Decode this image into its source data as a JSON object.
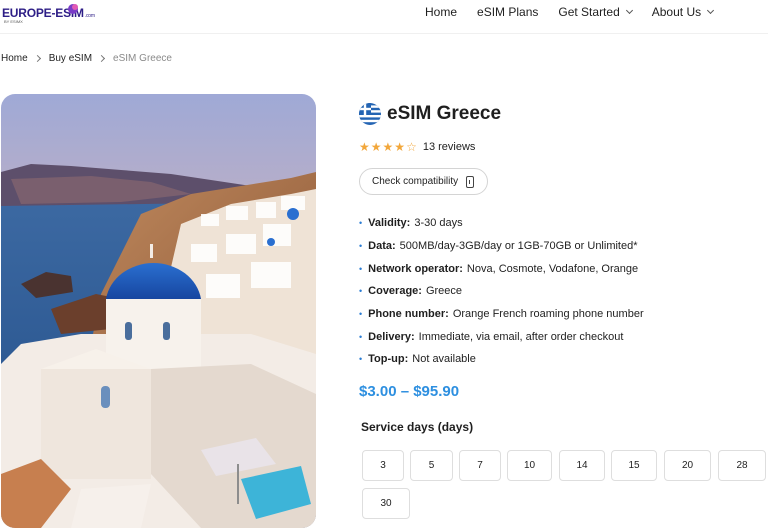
{
  "logo": {
    "text": "EUROPE-ESIM",
    "suffix": ".com",
    "tagline": "BY ESIMX"
  },
  "nav": {
    "home": "Home",
    "plans": "eSIM Plans",
    "started": "Get Started",
    "about": "About Us"
  },
  "breadcrumb": {
    "home": "Home",
    "buy": "Buy eSIM",
    "current": "eSIM Greece"
  },
  "product": {
    "title": "eSIM Greece",
    "rating": 4,
    "rating_max": 5,
    "reviews": "13 reviews",
    "compat_button": "Check compatibility",
    "specs": [
      {
        "label": "Validity:",
        "value": "3-30 days"
      },
      {
        "label": "Data:",
        "value": "500MB/day-3GB/day or 1GB-70GB or Unlimited*"
      },
      {
        "label": "Network operator:",
        "value": "Nova, Cosmote, Vodafone, Orange"
      },
      {
        "label": "Coverage:",
        "value": "Greece"
      },
      {
        "label": "Phone number:",
        "value": "Orange French roaming phone number"
      },
      {
        "label": "Delivery:",
        "value": "Immediate, via email, after order checkout"
      },
      {
        "label": "Top-up:",
        "value": "Not available"
      }
    ],
    "price": "$3.00 – $95.90",
    "service_days_title": "Service days (days)",
    "service_days": [
      "3",
      "5",
      "7",
      "10",
      "14",
      "15",
      "20",
      "28",
      "30"
    ]
  },
  "colors": {
    "brand": "#2d1d86",
    "price": "#2d8fe0",
    "star": "#f2a73b",
    "bullet": "#2b7cd3"
  }
}
